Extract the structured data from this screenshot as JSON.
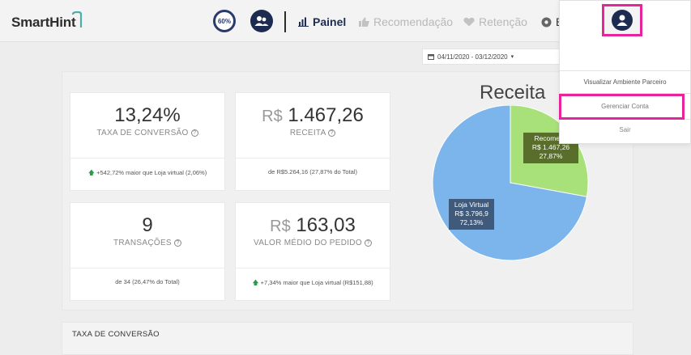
{
  "header": {
    "logo": "SmartHint",
    "progress": "60%",
    "nav": [
      {
        "label": "Painel",
        "icon": "bar-chart-icon",
        "active": true
      },
      {
        "label": "Recomendação",
        "icon": "thumbs-up-icon",
        "active": false
      },
      {
        "label": "Retenção",
        "icon": "heart-icon",
        "active": false
      },
      {
        "label": "B",
        "icon": "gear-icon",
        "active": false
      }
    ]
  },
  "date_filter": {
    "value": "04/11/2020 - 03/12/2020"
  },
  "cards": [
    {
      "value": "13,24%",
      "currency": "",
      "label": "TAXA DE CONVERSÃO",
      "footer": "+542,72% maior que Loja virtual (2,06%)",
      "trend": "up"
    },
    {
      "value": "1.467,26",
      "currency": "R$",
      "label": "RECEITA",
      "footer": "de R$5.264,16 (27,87% do Total)",
      "trend": ""
    },
    {
      "value": "9",
      "currency": "",
      "label": "TRANSAÇÕES",
      "footer": "de 34 (26,47% do Total)",
      "trend": ""
    },
    {
      "value": "163,03",
      "currency": "R$",
      "label": "VALOR MÉDIO DO PEDIDO",
      "footer": "+7,34% maior que Loja virtual (R$151,88)",
      "trend": "up"
    }
  ],
  "chart_data": {
    "type": "pie",
    "title": "Receita",
    "slices": [
      {
        "name": "Recomendação",
        "label_visible": "Recomend",
        "value_text": "R$ 1.467,26",
        "percent_text": "27,87%",
        "percent": 27.87,
        "color": "#a8e07a",
        "tooltip_color": "#5a6e2c"
      },
      {
        "name": "Loja Virtual",
        "label_visible": "Loja Virtual",
        "value_text": "R$ 3.796,9",
        "percent_text": "72,13%",
        "percent": 72.13,
        "color": "#7cb5ec",
        "tooltip_color": "#3f5a7a"
      }
    ]
  },
  "dropdown": {
    "items": [
      "Visualizar Ambiente Parceiro",
      "Gerenciar Conta",
      "Sair"
    ]
  },
  "bottom_section": {
    "title": "TAXA DE CONVERSÃO"
  },
  "colors": {
    "accent": "#1c2b4f",
    "highlight": "#e6249b",
    "up": "#2e9b4b"
  }
}
